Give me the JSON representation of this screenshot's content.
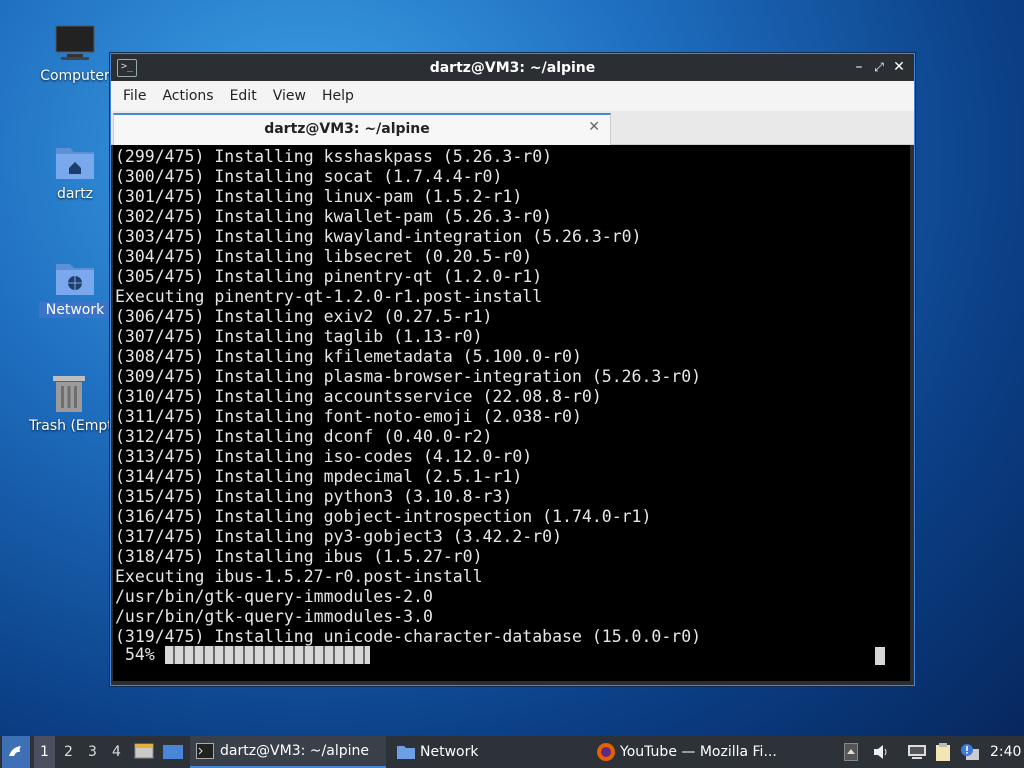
{
  "desktop": {
    "icons": [
      {
        "label": "Computer"
      },
      {
        "label": "dartz"
      },
      {
        "label": "Network"
      },
      {
        "label": "Trash (Empty)"
      }
    ]
  },
  "window": {
    "title": "dartz@VM3: ~/alpine",
    "menu": [
      "File",
      "Actions",
      "Edit",
      "View",
      "Help"
    ],
    "tab_title": "dartz@VM3: ~/alpine",
    "accent": "#4a86d8"
  },
  "terminal": {
    "lines": [
      "(299/475) Installing ksshaskpass (5.26.3-r0)",
      "(300/475) Installing socat (1.7.4.4-r0)",
      "(301/475) Installing linux-pam (1.5.2-r1)",
      "(302/475) Installing kwallet-pam (5.26.3-r0)",
      "(303/475) Installing kwayland-integration (5.26.3-r0)",
      "(304/475) Installing libsecret (0.20.5-r0)",
      "(305/475) Installing pinentry-qt (1.2.0-r1)",
      "Executing pinentry-qt-1.2.0-r1.post-install",
      "(306/475) Installing exiv2 (0.27.5-r1)",
      "(307/475) Installing taglib (1.13-r0)",
      "(308/475) Installing kfilemetadata (5.100.0-r0)",
      "(309/475) Installing plasma-browser-integration (5.26.3-r0)",
      "(310/475) Installing accountsservice (22.08.8-r0)",
      "(311/475) Installing font-noto-emoji (2.038-r0)",
      "(312/475) Installing dconf (0.40.0-r2)",
      "(313/475) Installing iso-codes (4.12.0-r0)",
      "(314/475) Installing mpdecimal (2.5.1-r1)",
      "(315/475) Installing python3 (3.10.8-r3)",
      "(316/475) Installing gobject-introspection (1.74.0-r1)",
      "(317/475) Installing py3-gobject3 (3.42.2-r0)",
      "(318/475) Installing ibus (1.5.27-r0)",
      "Executing ibus-1.5.27-r0.post-install",
      "/usr/bin/gtk-query-immodules-2.0",
      "/usr/bin/gtk-query-immodules-3.0",
      "(319/475) Installing unicode-character-database (15.0.0-r0)"
    ],
    "progress_label": "54%",
    "progress_value": 0.54
  },
  "taskbar": {
    "workspaces": [
      "1",
      "2",
      "3",
      "4"
    ],
    "active_workspace": "1",
    "tasks": [
      {
        "label": "dartz@VM3: ~/alpine",
        "icon": "terminal-icon"
      },
      {
        "label": "Network",
        "icon": "folder-icon"
      },
      {
        "label": "YouTube — Mozilla Fi...",
        "icon": "firefox-icon"
      }
    ],
    "clock": "2:40"
  }
}
